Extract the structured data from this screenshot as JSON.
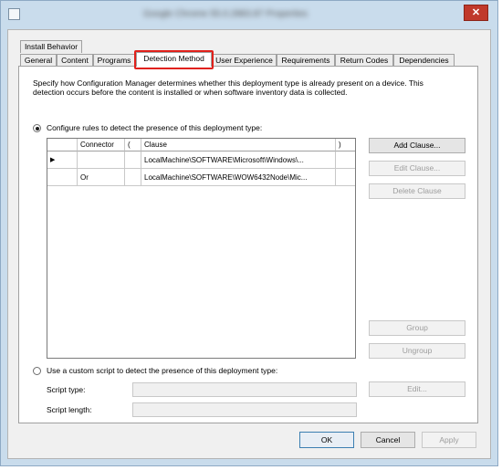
{
  "window": {
    "title": "Google Chrome 55.0.2883.87 Properties"
  },
  "tabs": {
    "row1": [
      "Install Behavior"
    ],
    "row2": [
      "General",
      "Content",
      "Programs",
      "Detection Method",
      "User Experience",
      "Requirements",
      "Return Codes",
      "Dependencies"
    ],
    "active": "Detection Method"
  },
  "page": {
    "description": "Specify how Configuration Manager determines whether this deployment type is already present on a device. This detection occurs before the content is installed or when software inventory data is collected.",
    "description_line1": "Specify how Configuration Manager determines whether this deployment type is already present on a device. This",
    "description_line2": "detection occurs before the content is installed or when software inventory data is collected.",
    "radio_rules_label": "Configure rules to detect the presence of this deployment type:",
    "radio_script_label": "Use a custom script to detect the presence of this deployment type:",
    "radio_selected": "rules",
    "script_type_label": "Script type:",
    "script_length_label": "Script length:"
  },
  "grid": {
    "columns": [
      "Connector",
      "(",
      "Clause",
      ")"
    ],
    "rows": [
      {
        "marker": "▶",
        "connector": "",
        "open": "",
        "clause": "LocalMachine\\SOFTWARE\\Microsoft\\Windows\\...",
        "close": ""
      },
      {
        "marker": "",
        "connector": "Or",
        "open": "",
        "clause": "LocalMachine\\SOFTWARE\\WOW6432Node\\Mic...",
        "close": ""
      }
    ]
  },
  "side_buttons": {
    "add_clause": "Add Clause...",
    "edit_clause": "Edit Clause...",
    "delete_clause": "Delete Clause",
    "group": "Group",
    "ungroup": "Ungroup",
    "edit": "Edit..."
  },
  "footer": {
    "ok": "OK",
    "cancel": "Cancel",
    "apply": "Apply"
  },
  "colors": {
    "highlight": "#e0211b",
    "close": "#c0392b",
    "frame": "#c9dcec"
  }
}
